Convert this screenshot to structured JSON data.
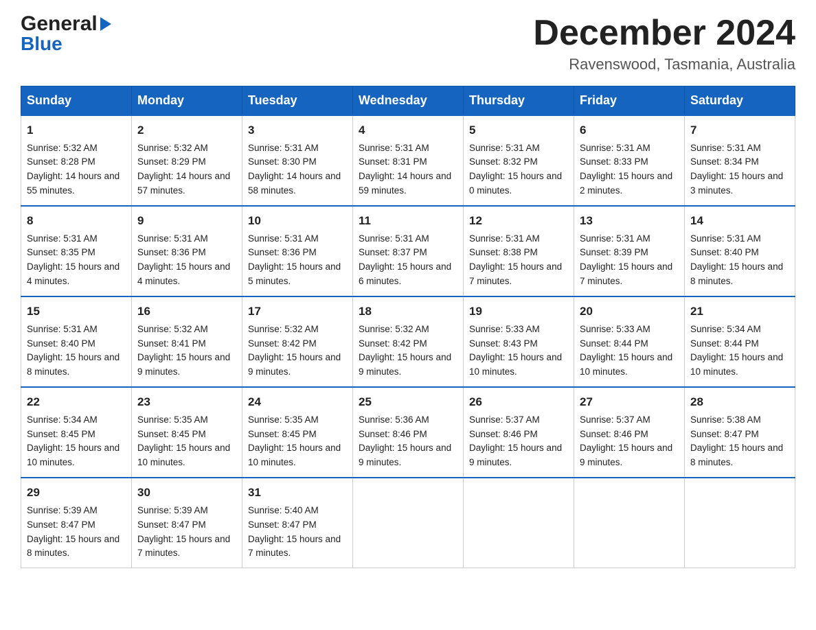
{
  "logo": {
    "line1": "General",
    "line2": "Blue"
  },
  "title": "December 2024",
  "subtitle": "Ravenswood, Tasmania, Australia",
  "days": [
    "Sunday",
    "Monday",
    "Tuesday",
    "Wednesday",
    "Thursday",
    "Friday",
    "Saturday"
  ],
  "weeks": [
    [
      {
        "num": "1",
        "sunrise": "5:32 AM",
        "sunset": "8:28 PM",
        "daylight": "14 hours and 55 minutes."
      },
      {
        "num": "2",
        "sunrise": "5:32 AM",
        "sunset": "8:29 PM",
        "daylight": "14 hours and 57 minutes."
      },
      {
        "num": "3",
        "sunrise": "5:31 AM",
        "sunset": "8:30 PM",
        "daylight": "14 hours and 58 minutes."
      },
      {
        "num": "4",
        "sunrise": "5:31 AM",
        "sunset": "8:31 PM",
        "daylight": "14 hours and 59 minutes."
      },
      {
        "num": "5",
        "sunrise": "5:31 AM",
        "sunset": "8:32 PM",
        "daylight": "15 hours and 0 minutes."
      },
      {
        "num": "6",
        "sunrise": "5:31 AM",
        "sunset": "8:33 PM",
        "daylight": "15 hours and 2 minutes."
      },
      {
        "num": "7",
        "sunrise": "5:31 AM",
        "sunset": "8:34 PM",
        "daylight": "15 hours and 3 minutes."
      }
    ],
    [
      {
        "num": "8",
        "sunrise": "5:31 AM",
        "sunset": "8:35 PM",
        "daylight": "15 hours and 4 minutes."
      },
      {
        "num": "9",
        "sunrise": "5:31 AM",
        "sunset": "8:36 PM",
        "daylight": "15 hours and 4 minutes."
      },
      {
        "num": "10",
        "sunrise": "5:31 AM",
        "sunset": "8:36 PM",
        "daylight": "15 hours and 5 minutes."
      },
      {
        "num": "11",
        "sunrise": "5:31 AM",
        "sunset": "8:37 PM",
        "daylight": "15 hours and 6 minutes."
      },
      {
        "num": "12",
        "sunrise": "5:31 AM",
        "sunset": "8:38 PM",
        "daylight": "15 hours and 7 minutes."
      },
      {
        "num": "13",
        "sunrise": "5:31 AM",
        "sunset": "8:39 PM",
        "daylight": "15 hours and 7 minutes."
      },
      {
        "num": "14",
        "sunrise": "5:31 AM",
        "sunset": "8:40 PM",
        "daylight": "15 hours and 8 minutes."
      }
    ],
    [
      {
        "num": "15",
        "sunrise": "5:31 AM",
        "sunset": "8:40 PM",
        "daylight": "15 hours and 8 minutes."
      },
      {
        "num": "16",
        "sunrise": "5:32 AM",
        "sunset": "8:41 PM",
        "daylight": "15 hours and 9 minutes."
      },
      {
        "num": "17",
        "sunrise": "5:32 AM",
        "sunset": "8:42 PM",
        "daylight": "15 hours and 9 minutes."
      },
      {
        "num": "18",
        "sunrise": "5:32 AM",
        "sunset": "8:42 PM",
        "daylight": "15 hours and 9 minutes."
      },
      {
        "num": "19",
        "sunrise": "5:33 AM",
        "sunset": "8:43 PM",
        "daylight": "15 hours and 10 minutes."
      },
      {
        "num": "20",
        "sunrise": "5:33 AM",
        "sunset": "8:44 PM",
        "daylight": "15 hours and 10 minutes."
      },
      {
        "num": "21",
        "sunrise": "5:34 AM",
        "sunset": "8:44 PM",
        "daylight": "15 hours and 10 minutes."
      }
    ],
    [
      {
        "num": "22",
        "sunrise": "5:34 AM",
        "sunset": "8:45 PM",
        "daylight": "15 hours and 10 minutes."
      },
      {
        "num": "23",
        "sunrise": "5:35 AM",
        "sunset": "8:45 PM",
        "daylight": "15 hours and 10 minutes."
      },
      {
        "num": "24",
        "sunrise": "5:35 AM",
        "sunset": "8:45 PM",
        "daylight": "15 hours and 10 minutes."
      },
      {
        "num": "25",
        "sunrise": "5:36 AM",
        "sunset": "8:46 PM",
        "daylight": "15 hours and 9 minutes."
      },
      {
        "num": "26",
        "sunrise": "5:37 AM",
        "sunset": "8:46 PM",
        "daylight": "15 hours and 9 minutes."
      },
      {
        "num": "27",
        "sunrise": "5:37 AM",
        "sunset": "8:46 PM",
        "daylight": "15 hours and 9 minutes."
      },
      {
        "num": "28",
        "sunrise": "5:38 AM",
        "sunset": "8:47 PM",
        "daylight": "15 hours and 8 minutes."
      }
    ],
    [
      {
        "num": "29",
        "sunrise": "5:39 AM",
        "sunset": "8:47 PM",
        "daylight": "15 hours and 8 minutes."
      },
      {
        "num": "30",
        "sunrise": "5:39 AM",
        "sunset": "8:47 PM",
        "daylight": "15 hours and 7 minutes."
      },
      {
        "num": "31",
        "sunrise": "5:40 AM",
        "sunset": "8:47 PM",
        "daylight": "15 hours and 7 minutes."
      },
      null,
      null,
      null,
      null
    ]
  ],
  "labels": {
    "sunrise": "Sunrise:",
    "sunset": "Sunset:",
    "daylight": "Daylight:"
  }
}
